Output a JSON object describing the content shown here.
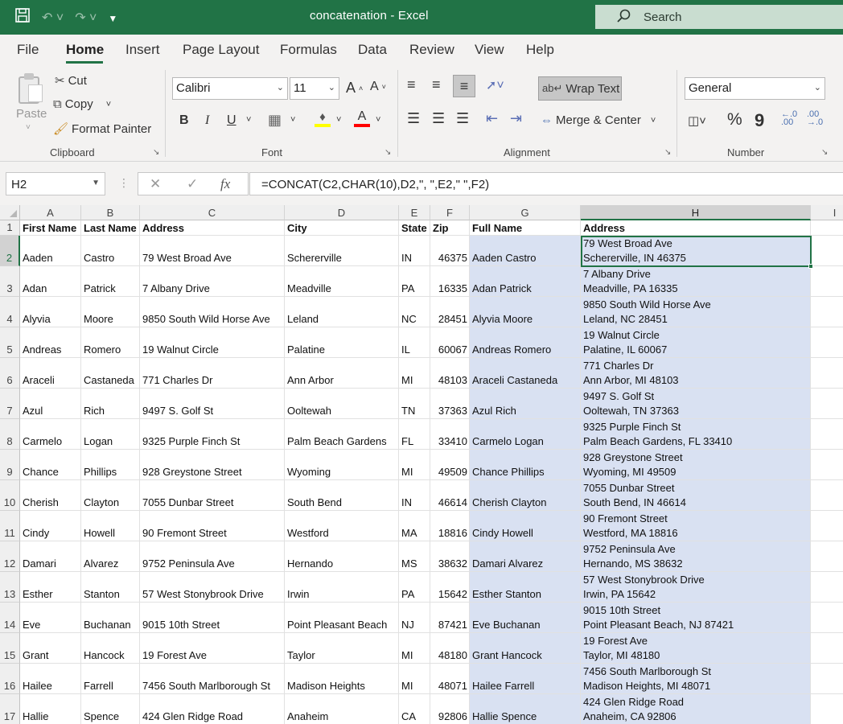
{
  "titlebar": {
    "title": "concatenation  -  Excel",
    "search_label": "Search",
    "icons": [
      "save-icon",
      "undo-icon",
      "redo-icon",
      "customize-qat-icon",
      "search-icon"
    ]
  },
  "menu": {
    "tabs": [
      "File",
      "Home",
      "Insert",
      "Page Layout",
      "Formulas",
      "Data",
      "Review",
      "View",
      "Help"
    ],
    "active": "Home"
  },
  "ribbon": {
    "clipboard": {
      "group_label": "Clipboard",
      "paste": "Paste",
      "cut": "Cut",
      "copy": "Copy",
      "format_painter": "Format Painter"
    },
    "font": {
      "group_label": "Font",
      "font_name": "Calibri",
      "font_size": "11",
      "bold": "B",
      "italic": "I",
      "underline": "U",
      "highlight_color": "#ffff00",
      "font_color": "#ff0000"
    },
    "alignment": {
      "group_label": "Alignment",
      "wrap_text": "Wrap Text",
      "merge_center": "Merge & Center"
    },
    "number": {
      "group_label": "Number",
      "format": "General",
      "percent": "%",
      "comma": "9"
    }
  },
  "formula_bar": {
    "name_box": "H2",
    "fx": "fx",
    "formula": "=CONCAT(C2,CHAR(10),D2,\", \",E2,\" \",F2)"
  },
  "sheet": {
    "columns": [
      "A",
      "B",
      "C",
      "D",
      "E",
      "F",
      "G",
      "H",
      "I"
    ],
    "selected_column": "H",
    "selected_row": "2",
    "highlight_color": "#d9e1f2",
    "header_row": {
      "num": "1",
      "a": "First Name",
      "b": "Last Name",
      "c": "Address",
      "d": "City",
      "e": "State",
      "f": "Zip",
      "g": "Full Name",
      "h": "Address"
    },
    "rows": [
      {
        "num": "2",
        "a": "Aaden",
        "b": "Castro",
        "c": "79 West Broad Ave",
        "d": "Schererville",
        "e": "IN",
        "f": "46375",
        "g": "Aaden Castro",
        "h1": "79 West Broad Ave",
        "h2": "Schererville, IN 46375"
      },
      {
        "num": "3",
        "a": "Adan",
        "b": "Patrick",
        "c": "7 Albany Drive",
        "d": "Meadville",
        "e": "PA",
        "f": "16335",
        "g": "Adan Patrick",
        "h1": "7 Albany Drive",
        "h2": "Meadville, PA 16335"
      },
      {
        "num": "4",
        "a": "Alyvia",
        "b": "Moore",
        "c": "9850 South Wild Horse Ave",
        "d": "Leland",
        "e": "NC",
        "f": "28451",
        "g": "Alyvia Moore",
        "h1": "9850 South Wild Horse Ave",
        "h2": "Leland, NC 28451"
      },
      {
        "num": "5",
        "a": "Andreas",
        "b": "Romero",
        "c": "19 Walnut Circle",
        "d": "Palatine",
        "e": "IL",
        "f": "60067",
        "g": "Andreas Romero",
        "h1": "19 Walnut Circle",
        "h2": "Palatine, IL 60067"
      },
      {
        "num": "6",
        "a": "Araceli",
        "b": "Castaneda",
        "c": "771 Charles Dr",
        "d": "Ann Arbor",
        "e": "MI",
        "f": "48103",
        "g": "Araceli Castaneda",
        "h1": "771 Charles Dr",
        "h2": "Ann Arbor, MI 48103"
      },
      {
        "num": "7",
        "a": "Azul",
        "b": "Rich",
        "c": "9497 S. Golf St",
        "d": "Ooltewah",
        "e": "TN",
        "f": "37363",
        "g": "Azul Rich",
        "h1": "9497 S. Golf St",
        "h2": "Ooltewah, TN 37363"
      },
      {
        "num": "8",
        "a": "Carmelo",
        "b": "Logan",
        "c": "9325 Purple Finch St",
        "d": "Palm Beach Gardens",
        "e": "FL",
        "f": "33410",
        "g": "Carmelo Logan",
        "h1": "9325 Purple Finch St",
        "h2": "Palm Beach Gardens, FL 33410"
      },
      {
        "num": "9",
        "a": "Chance",
        "b": "Phillips",
        "c": "928 Greystone Street",
        "d": "Wyoming",
        "e": "MI",
        "f": "49509",
        "g": "Chance Phillips",
        "h1": "928 Greystone Street",
        "h2": "Wyoming, MI 49509"
      },
      {
        "num": "10",
        "a": "Cherish",
        "b": "Clayton",
        "c": "7055 Dunbar Street",
        "d": "South Bend",
        "e": "IN",
        "f": "46614",
        "g": "Cherish Clayton",
        "h1": "7055 Dunbar Street",
        "h2": "South Bend, IN 46614"
      },
      {
        "num": "11",
        "a": "Cindy",
        "b": "Howell",
        "c": "90 Fremont Street",
        "d": "Westford",
        "e": "MA",
        "f": "18816",
        "g": "Cindy Howell",
        "h1": "90 Fremont Street",
        "h2": "Westford, MA 18816"
      },
      {
        "num": "12",
        "a": "Damari",
        "b": "Alvarez",
        "c": "9752 Peninsula Ave",
        "d": "Hernando",
        "e": "MS",
        "f": "38632",
        "g": "Damari Alvarez",
        "h1": "9752 Peninsula Ave",
        "h2": "Hernando, MS 38632"
      },
      {
        "num": "13",
        "a": "Esther",
        "b": "Stanton",
        "c": "57 West Stonybrook Drive",
        "d": "Irwin",
        "e": "PA",
        "f": "15642",
        "g": "Esther Stanton",
        "h1": "57 West Stonybrook Drive",
        "h2": "Irwin, PA 15642"
      },
      {
        "num": "14",
        "a": "Eve",
        "b": "Buchanan",
        "c": "9015 10th Street",
        "d": "Point Pleasant Beach",
        "e": "NJ",
        "f": "87421",
        "g": "Eve Buchanan",
        "h1": "9015 10th Street",
        "h2": "Point Pleasant Beach, NJ 87421"
      },
      {
        "num": "15",
        "a": "Grant",
        "b": "Hancock",
        "c": "19 Forest Ave",
        "d": "Taylor",
        "e": "MI",
        "f": "48180",
        "g": "Grant Hancock",
        "h1": "19 Forest Ave",
        "h2": "Taylor, MI 48180"
      },
      {
        "num": "16",
        "a": "Hailee",
        "b": "Farrell",
        "c": "7456 South Marlborough St",
        "d": "Madison Heights",
        "e": "MI",
        "f": "48071",
        "g": "Hailee Farrell",
        "h1": "7456 South Marlborough St",
        "h2": "Madison Heights, MI 48071"
      },
      {
        "num": "17",
        "a": "Hallie",
        "b": "Spence",
        "c": "424 Glen Ridge Road",
        "d": "Anaheim",
        "e": "CA",
        "f": "92806",
        "g": "Hallie Spence",
        "h1": "424 Glen Ridge Road",
        "h2": "Anaheim, CA 92806"
      }
    ]
  }
}
